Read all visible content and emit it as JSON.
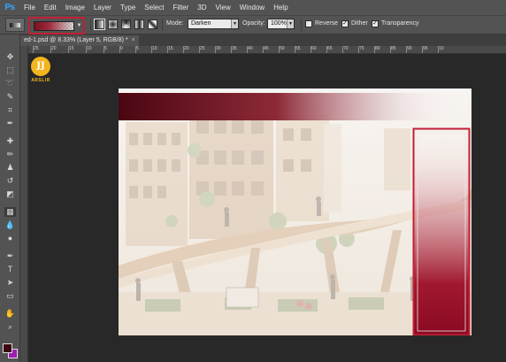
{
  "app": {
    "logo": "Ps"
  },
  "menu": [
    "File",
    "Edit",
    "Image",
    "Layer",
    "Type",
    "Select",
    "Filter",
    "3D",
    "View",
    "Window",
    "Help"
  ],
  "options": {
    "mode_label": "Mode:",
    "mode_value": "Darken",
    "opacity_label": "Opacity:",
    "opacity_value": "100%",
    "reverse_label": "Reverse",
    "dither_label": "Dither",
    "transparency_label": "Transparency",
    "reverse_checked": false,
    "dither_checked": true,
    "transparency_checked": true,
    "gradient_colors": [
      "#7a0f1e",
      "#a03040",
      "#c8c8c8"
    ]
  },
  "document": {
    "tab_title": "ed-1.psd @ 8.33% (Layer 5, RGB/8) *",
    "close_glyph": "×"
  },
  "ruler": {
    "h_ticks": [
      "25",
      "20",
      "15",
      "10",
      "5",
      "0",
      "5",
      "10",
      "15",
      "20",
      "25",
      "30",
      "35",
      "40",
      "45",
      "50",
      "55",
      "60",
      "65",
      "70",
      "75",
      "80",
      "85",
      "90",
      "95",
      "10"
    ]
  },
  "logo": {
    "text": "ARSLIR",
    "glyph": "JJ"
  },
  "colors": {
    "foreground": "#3a0810",
    "background": "#9c1db0",
    "accent_highlight": "#c21f34"
  }
}
